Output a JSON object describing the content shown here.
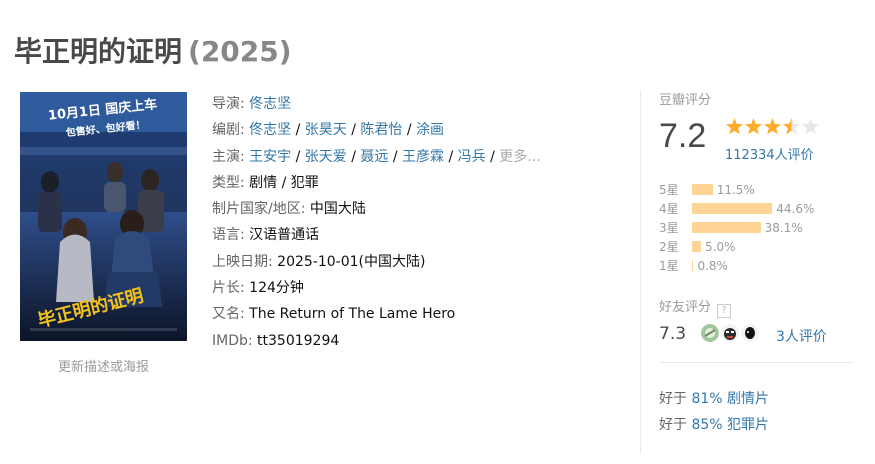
{
  "page": {
    "title": "毕正明的证明",
    "year": "(2025)"
  },
  "poster": {
    "top_text_1": "10月1日 国庆上车",
    "top_text_2": "包售好、包好看！",
    "big_title": "毕正明的证明",
    "update_link": "更新描述或海报"
  },
  "info": {
    "director": {
      "label": "导演:",
      "names": [
        "佟志坚"
      ]
    },
    "writer": {
      "label": "编剧:",
      "names": [
        "佟志坚",
        "张昊天",
        "陈君怡",
        "涂画"
      ]
    },
    "cast": {
      "label": "主演:",
      "names": [
        "王安宇",
        "张天爱",
        "聂远",
        "王彦霖",
        "冯兵"
      ],
      "more": "更多..."
    },
    "genre": {
      "label": "类型:",
      "value": "剧情 / 犯罪"
    },
    "country": {
      "label": "制片国家/地区:",
      "value": "中国大陆"
    },
    "language": {
      "label": "语言:",
      "value": "汉语普通话"
    },
    "release": {
      "label": "上映日期:",
      "value": "2025-10-01(中国大陆)"
    },
    "runtime": {
      "label": "片长:",
      "value": "124分钟"
    },
    "aka": {
      "label": "又名:",
      "value": "The Return of The Lame Hero"
    },
    "imdb": {
      "label": "IMDb:",
      "value": "tt35019294"
    }
  },
  "rating": {
    "title": "豆瓣评分",
    "score": "7.2",
    "stars": 3.5,
    "votes": "112334人评价",
    "distribution": [
      {
        "label": "5星",
        "percent": 11.5,
        "text": "11.5%"
      },
      {
        "label": "4星",
        "percent": 44.6,
        "text": "44.6%"
      },
      {
        "label": "3星",
        "percent": 38.1,
        "text": "38.1%"
      },
      {
        "label": "2星",
        "percent": 5.0,
        "text": "5.0%"
      },
      {
        "label": "1星",
        "percent": 0.8,
        "text": "0.8%"
      }
    ]
  },
  "friends": {
    "title": "好友评分",
    "help": "?",
    "score": "7.3",
    "count": "3人评价"
  },
  "better_than": [
    {
      "prefix": "好于",
      "value": "81% 剧情片"
    },
    {
      "prefix": "好于",
      "value": "85% 犯罪片"
    }
  ],
  "colors": {
    "link": "#3377aa",
    "star": "#ffac2d",
    "bar": "#ffd596",
    "title": "#494949"
  }
}
